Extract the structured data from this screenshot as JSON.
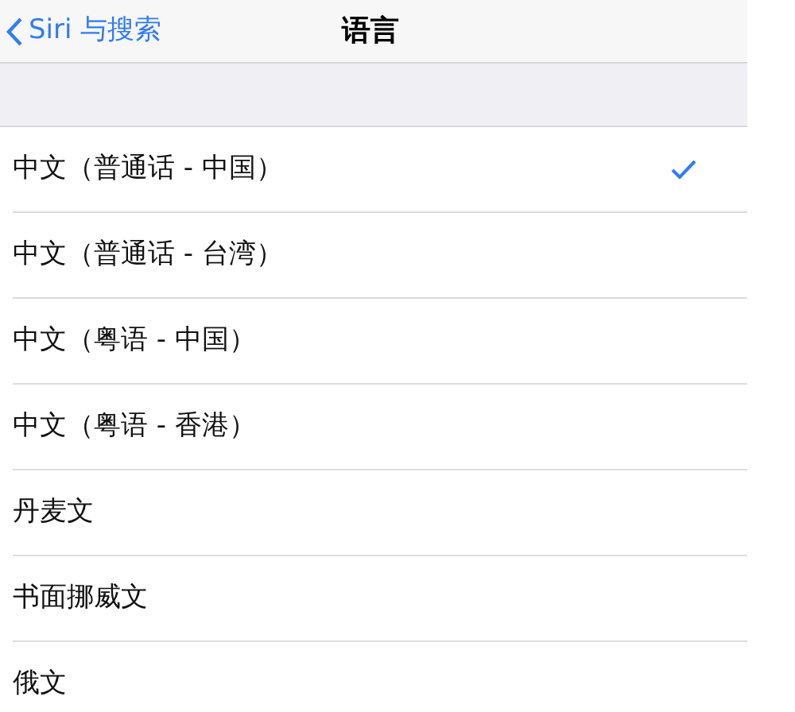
{
  "nav": {
    "back": "Siri 与搜索",
    "title": "语言"
  },
  "languages": [
    {
      "label": "中文（普通话 - 中国）",
      "selected": true
    },
    {
      "label": "中文（普通话 - 台湾）",
      "selected": false
    },
    {
      "label": "中文（粤语 - 中国）",
      "selected": false
    },
    {
      "label": "中文（粤语 - 香港）",
      "selected": false
    },
    {
      "label": "丹麦文",
      "selected": false
    },
    {
      "label": "书面挪威文",
      "selected": false
    },
    {
      "label": "俄文",
      "selected": false
    }
  ]
}
